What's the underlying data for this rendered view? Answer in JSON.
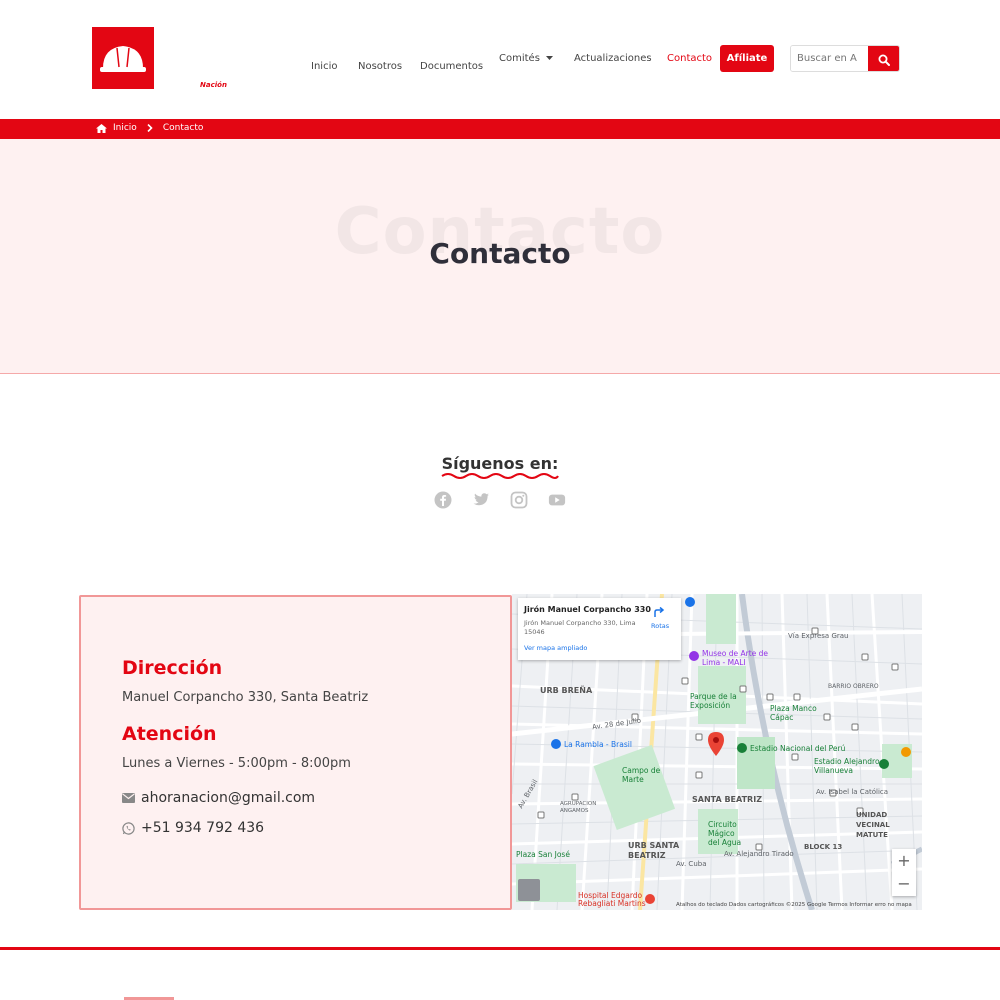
{
  "header": {
    "logo_text": "Nación",
    "nav": [
      {
        "label": "Inicio"
      },
      {
        "label": "Nosotros"
      },
      {
        "label": "Documentos"
      },
      {
        "label": "Comités"
      },
      {
        "label": "Actualizaciones"
      },
      {
        "label": "Contacto",
        "active": true
      }
    ],
    "cta": "Afíliate",
    "search_placeholder": "Buscar en A"
  },
  "breadcrumb": {
    "home": "Inicio",
    "current": "Contacto"
  },
  "hero": {
    "ghost": "Contacto",
    "title": "Contacto"
  },
  "follow": {
    "title": "Síguenos en:",
    "networks": [
      "facebook-icon",
      "twitter-icon",
      "instagram-icon",
      "youtube-icon"
    ]
  },
  "contact": {
    "address_heading": "Dirección",
    "address": "Manuel Corpancho 330, Santa Beatriz",
    "hours_heading": "Atención",
    "hours": "Lunes a Viernes - 5:00pm - 8:00pm",
    "email": "ahoranacion@gmail.com",
    "phone": "+51 934 792 436"
  },
  "map": {
    "place_title": "Jirón Manuel Corpancho 330",
    "place_address": "Jirón Manuel Corpancho 330, Lima 15046",
    "directions": "Rotas",
    "larger_map": "Ver mapa ampliado",
    "labels": {
      "urb_brena": "URB BREÑA",
      "museo": "Museo de Arte de Lima - MALI",
      "parque": "Parque de la Exposición",
      "plaza_manco": "Plaza Manco Cápac",
      "estadio": "Estadio Nacional del Perú",
      "estadio_villanueva": "Estadio Alejandro Villanueva",
      "rambla": "La Rambla - Brasil",
      "campo": "Campo de Marte",
      "santa_beatriz": "SANTA BEATRIZ",
      "circuito": "Circuito Mágico del Agua",
      "urb_santa_beatriz": "URB SANTA BEATRIZ",
      "plaza_san_jose": "Plaza San José",
      "hospital": "Hospital Edgardo Rebagliati Martins",
      "unidad_vecinal": "UNIDAD VECINAL MATUTE",
      "block13": "BLOCK 13",
      "barrio_obrero": "BARRIO OBRERO",
      "via_expresa": "Vía Expresa Grau",
      "av_28": "Av. 28 de Julio",
      "av_brasil": "Av. Brasil",
      "av_cuba": "Av. Cuba",
      "av_isabel": "Av. Isabel la Católica",
      "av_tirado": "Av. Alejandro Tirado",
      "agrupacion": "AGRUPACION ANGAMOS"
    },
    "attribution": "Atalhos do teclado    Dados cartográficos ©2025 Google    Termos    Informar erro no mapa"
  },
  "colors": {
    "brand": "#e30613",
    "hero_bg": "#fef1f1",
    "card_border": "#f19797"
  }
}
